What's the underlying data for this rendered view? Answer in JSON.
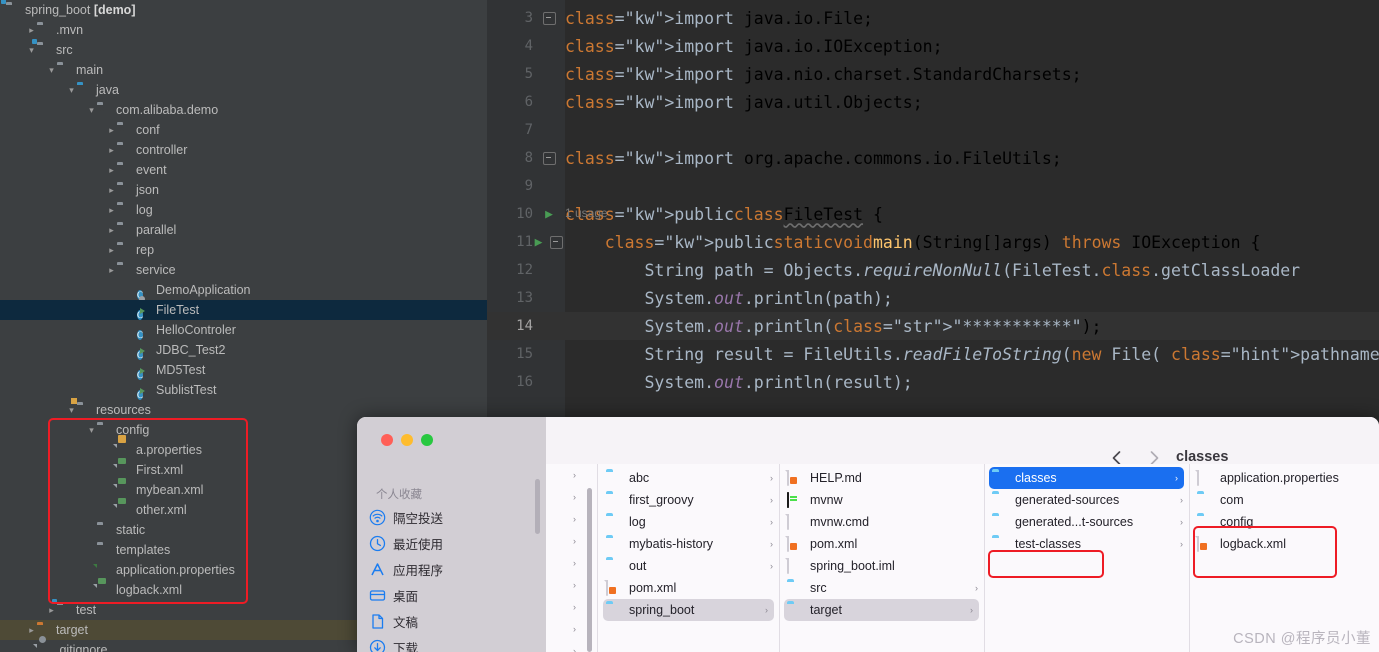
{
  "ide": {
    "project_title": "spring_boot",
    "project_title_suffix": "[demo]",
    "tree": [
      {
        "label": ".mvn",
        "indent": 1,
        "twisty": "collapsed",
        "icon": "folder-icon"
      },
      {
        "label": "src",
        "indent": 1,
        "twisty": "expanded",
        "icon": "source-folder-icon"
      },
      {
        "label": "main",
        "indent": 2,
        "twisty": "expanded",
        "icon": "folder-icon"
      },
      {
        "label": "java",
        "indent": 3,
        "twisty": "expanded",
        "icon": "java-source-folder-icon"
      },
      {
        "label": "com.alibaba.demo",
        "indent": 4,
        "twisty": "expanded",
        "icon": "package-icon"
      },
      {
        "label": "conf",
        "indent": 5,
        "twisty": "collapsed",
        "icon": "package-icon"
      },
      {
        "label": "controller",
        "indent": 5,
        "twisty": "collapsed",
        "icon": "package-icon"
      },
      {
        "label": "event",
        "indent": 5,
        "twisty": "collapsed",
        "icon": "package-icon"
      },
      {
        "label": "json",
        "indent": 5,
        "twisty": "collapsed",
        "icon": "package-icon"
      },
      {
        "label": "log",
        "indent": 5,
        "twisty": "collapsed",
        "icon": "package-icon"
      },
      {
        "label": "parallel",
        "indent": 5,
        "twisty": "collapsed",
        "icon": "package-icon"
      },
      {
        "label": "rep",
        "indent": 5,
        "twisty": "collapsed",
        "icon": "package-icon"
      },
      {
        "label": "service",
        "indent": 5,
        "twisty": "collapsed",
        "icon": "package-icon"
      },
      {
        "label": "DemoApplication",
        "indent": 6,
        "twisty": "none",
        "icon": "spring-class-icon"
      },
      {
        "label": "FileTest",
        "indent": 6,
        "twisty": "none",
        "icon": "runnable-class-icon",
        "state": "selected"
      },
      {
        "label": "HelloControler",
        "indent": 6,
        "twisty": "none",
        "icon": "class-icon"
      },
      {
        "label": "JDBC_Test2",
        "indent": 6,
        "twisty": "none",
        "icon": "runnable-class-icon"
      },
      {
        "label": "MD5Test",
        "indent": 6,
        "twisty": "none",
        "icon": "runnable-class-icon"
      },
      {
        "label": "SublistTest",
        "indent": 6,
        "twisty": "none",
        "icon": "runnable-class-icon"
      },
      {
        "label": "resources",
        "indent": 3,
        "twisty": "expanded",
        "icon": "resources-folder-icon"
      },
      {
        "label": "config",
        "indent": 4,
        "twisty": "expanded",
        "icon": "folder-icon"
      },
      {
        "label": "a.properties",
        "indent": 5,
        "twisty": "none",
        "icon": "properties-file-icon"
      },
      {
        "label": "First.xml",
        "indent": 5,
        "twisty": "none",
        "icon": "xml-file-icon"
      },
      {
        "label": "mybean.xml",
        "indent": 5,
        "twisty": "none",
        "icon": "xml-file-icon"
      },
      {
        "label": "other.xml",
        "indent": 5,
        "twisty": "none",
        "icon": "xml-file-icon"
      },
      {
        "label": "static",
        "indent": 4,
        "twisty": "none",
        "icon": "folder-icon"
      },
      {
        "label": "templates",
        "indent": 4,
        "twisty": "none",
        "icon": "folder-icon"
      },
      {
        "label": "application.properties",
        "indent": 4,
        "twisty": "none",
        "icon": "spring-properties-icon"
      },
      {
        "label": "logback.xml",
        "indent": 4,
        "twisty": "none",
        "icon": "xml-file-icon"
      },
      {
        "label": "test",
        "indent": 2,
        "twisty": "collapsed",
        "icon": "test-folder-icon"
      },
      {
        "label": "target",
        "indent": 1,
        "twisty": "collapsed",
        "icon": "target-folder-icon",
        "state": "target"
      },
      {
        "label": ".gitignore",
        "indent": 1,
        "twisty": "none",
        "icon": "git-file-icon"
      }
    ]
  },
  "editor": {
    "usage_hint": "1 usage",
    "lines": [
      {
        "num": "3",
        "gutter": "fold-open",
        "text": "import java.io.File;"
      },
      {
        "num": "4",
        "gutter": "",
        "text": "import java.io.IOException;"
      },
      {
        "num": "5",
        "gutter": "",
        "text": "import java.nio.charset.StandardCharsets;"
      },
      {
        "num": "6",
        "gutter": "",
        "text": "import java.util.Objects;"
      },
      {
        "num": "7",
        "gutter": "",
        "text": ""
      },
      {
        "num": "8",
        "gutter": "fold-open",
        "text": "import org.apache.commons.io.FileUtils;"
      },
      {
        "num": "9",
        "gutter": "",
        "text": ""
      },
      {
        "num": "10",
        "gutter": "run",
        "text": "public  class FileTest {"
      },
      {
        "num": "11",
        "gutter": "run-fold",
        "text": "    public static void main(String[]args) throws IOException {"
      },
      {
        "num": "12",
        "gutter": "",
        "text": "        String path = Objects.requireNonNull(FileTest.class.getClassLoader"
      },
      {
        "num": "13",
        "gutter": "",
        "text": "        System.out.println(path);"
      },
      {
        "num": "14",
        "gutter": "",
        "text": "        System.out.println(\"***********\");",
        "state": "current"
      },
      {
        "num": "15",
        "gutter": "",
        "text": "        String result = FileUtils.readFileToString(new File( pathname: path+"
      },
      {
        "num": "16",
        "gutter": "",
        "text": "        System.out.println(result);"
      }
    ],
    "inlay_hint": "pathname:"
  },
  "finder": {
    "title": "classes",
    "nav": {
      "back": "back-chevron",
      "forward": "forward-chevron"
    },
    "toolbar": [
      {
        "name": "icon-view-button",
        "icon": "grid-icon"
      },
      {
        "name": "list-view-button",
        "icon": "list-icon"
      },
      {
        "name": "column-view-button",
        "icon": "columns-icon",
        "active": true
      },
      {
        "name": "gallery-view-button",
        "icon": "gallery-icon"
      },
      {
        "name": "group-by-button",
        "icon": "group-icon",
        "chevron": true
      },
      {
        "name": "share-button",
        "icon": "share-icon"
      },
      {
        "name": "tag-button",
        "icon": "tag-icon"
      },
      {
        "name": "more-button",
        "icon": "ellipsis-icon",
        "chevron": true
      }
    ],
    "search_placeholder": "",
    "sidebar": {
      "header": "个人收藏",
      "items": [
        {
          "label": "隔空投送",
          "icon": "airdrop-icon"
        },
        {
          "label": "最近使用",
          "icon": "recents-clock-icon"
        },
        {
          "label": "应用程序",
          "icon": "applications-icon"
        },
        {
          "label": "桌面",
          "icon": "desktop-icon"
        },
        {
          "label": "文稿",
          "icon": "documents-icon"
        },
        {
          "label": "下载",
          "icon": "downloads-icon"
        }
      ]
    },
    "columns": [
      {
        "name": "column-projects",
        "items": [
          {
            "label": "abc",
            "icon": "blue-folder-icon",
            "chevron": true
          },
          {
            "label": "first_groovy",
            "icon": "blue-folder-icon",
            "chevron": true
          },
          {
            "label": "log",
            "icon": "blue-folder-icon",
            "chevron": true
          },
          {
            "label": "mybatis-history",
            "icon": "blue-folder-icon",
            "chevron": true
          },
          {
            "label": "out",
            "icon": "blue-folder-icon",
            "chevron": true
          },
          {
            "label": "pom.xml",
            "icon": "xml-doc-icon",
            "chevron": false
          },
          {
            "label": "spring_boot",
            "icon": "blue-folder-icon",
            "chevron": true,
            "state": "selected"
          }
        ]
      },
      {
        "name": "column-spring-boot",
        "items": [
          {
            "label": "HELP.md",
            "icon": "markdown-doc-icon",
            "chevron": false
          },
          {
            "label": "mvnw",
            "icon": "terminal-icon",
            "chevron": false
          },
          {
            "label": "mvnw.cmd",
            "icon": "plain-doc-icon",
            "chevron": false
          },
          {
            "label": "pom.xml",
            "icon": "xml-doc-icon",
            "chevron": false
          },
          {
            "label": "spring_boot.iml",
            "icon": "plain-doc-icon",
            "chevron": false
          },
          {
            "label": "src",
            "icon": "blue-folder-icon",
            "chevron": true
          },
          {
            "label": "target",
            "icon": "blue-folder-icon",
            "chevron": true,
            "state": "selected"
          }
        ]
      },
      {
        "name": "column-target",
        "items": [
          {
            "label": "classes",
            "icon": "blue-folder-icon",
            "chevron": true,
            "state": "selected-blue"
          },
          {
            "label": "generated-sources",
            "icon": "blue-folder-icon",
            "chevron": true
          },
          {
            "label": "generated...t-sources",
            "icon": "blue-folder-icon",
            "chevron": true
          },
          {
            "label": "test-classes",
            "icon": "blue-folder-icon",
            "chevron": true,
            "highlight": "red-box"
          }
        ]
      },
      {
        "name": "column-classes",
        "items": [
          {
            "label": "application.properties",
            "icon": "plain-doc-icon",
            "chevron": false
          },
          {
            "label": "com",
            "icon": "blue-folder-icon",
            "chevron": true
          },
          {
            "label": "config",
            "icon": "blue-folder-icon",
            "chevron": true,
            "highlight": "red-box"
          },
          {
            "label": "logback.xml",
            "icon": "xml-doc-icon",
            "chevron": false,
            "highlight": "red-box"
          }
        ]
      }
    ]
  },
  "watermark": "CSDN @程序员小董",
  "colors": {
    "ide_bg": "#3c3f41",
    "editor_bg": "#2b2b2b",
    "selection": "#0d293e",
    "target_row": "#4e4a36",
    "keyword_orange": "#cc7832",
    "string_green": "#6a8759",
    "finder_accent": "#1a6ff0",
    "annotation_red": "#ee1c25"
  }
}
